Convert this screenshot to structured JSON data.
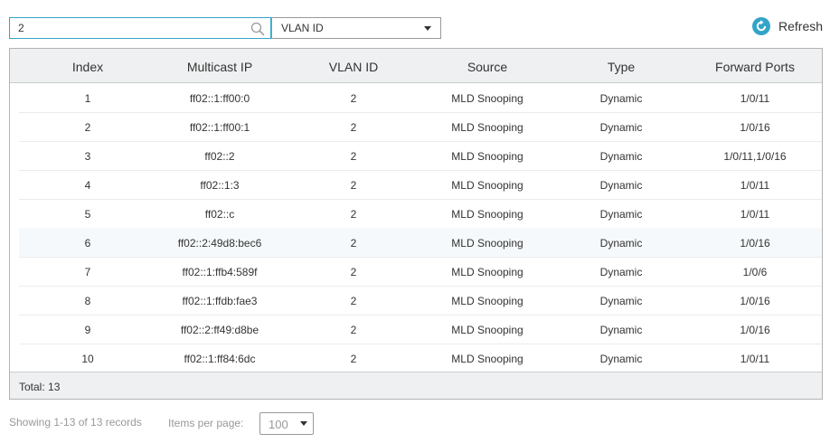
{
  "toolbar": {
    "search_value": "2",
    "filter_selected": "VLAN ID",
    "refresh_label": "Refresh",
    "accent_color": "#33a4c8"
  },
  "table": {
    "columns": [
      "Index",
      "Multicast IP",
      "VLAN ID",
      "Source",
      "Type",
      "Forward Ports"
    ],
    "rows": [
      [
        "1",
        "ff02::1:ff00:0",
        "2",
        "MLD Snooping",
        "Dynamic",
        "1/0/11"
      ],
      [
        "2",
        "ff02::1:ff00:1",
        "2",
        "MLD Snooping",
        "Dynamic",
        "1/0/16"
      ],
      [
        "3",
        "ff02::2",
        "2",
        "MLD Snooping",
        "Dynamic",
        "1/0/11,1/0/16"
      ],
      [
        "4",
        "ff02::1:3",
        "2",
        "MLD Snooping",
        "Dynamic",
        "1/0/11"
      ],
      [
        "5",
        "ff02::c",
        "2",
        "MLD Snooping",
        "Dynamic",
        "1/0/11"
      ],
      [
        "6",
        "ff02::2:49d8:bec6",
        "2",
        "MLD Snooping",
        "Dynamic",
        "1/0/16"
      ],
      [
        "7",
        "ff02::1:ffb4:589f",
        "2",
        "MLD Snooping",
        "Dynamic",
        "1/0/6"
      ],
      [
        "8",
        "ff02::1:ffdb:fae3",
        "2",
        "MLD Snooping",
        "Dynamic",
        "1/0/16"
      ],
      [
        "9",
        "ff02::2:ff49:d8be",
        "2",
        "MLD Snooping",
        "Dynamic",
        "1/0/16"
      ],
      [
        "10",
        "ff02::1:ff84:6dc",
        "2",
        "MLD Snooping",
        "Dynamic",
        "1/0/11"
      ]
    ],
    "highlighted_row": 5,
    "total_label": "Total: 13"
  },
  "pager": {
    "showing_text": "Showing 1-13 of 13 records",
    "items_per_page_label": "Items per page:",
    "items_per_page_value": "100"
  }
}
